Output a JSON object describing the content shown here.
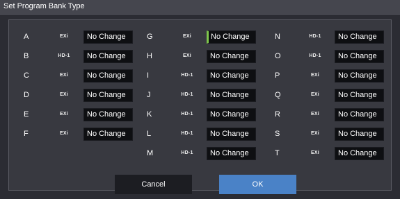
{
  "dialog": {
    "title": "Set Program Bank Type"
  },
  "columns": [
    {
      "rows": [
        {
          "bank": "A",
          "type": "EXi",
          "value": "No Change"
        },
        {
          "bank": "B",
          "type": "HD-1",
          "value": "No Change"
        },
        {
          "bank": "C",
          "type": "EXi",
          "value": "No Change"
        },
        {
          "bank": "D",
          "type": "EXi",
          "value": "No Change"
        },
        {
          "bank": "E",
          "type": "EXi",
          "value": "No Change"
        },
        {
          "bank": "F",
          "type": "EXi",
          "value": "No Change"
        }
      ]
    },
    {
      "rows": [
        {
          "bank": "G",
          "type": "EXi",
          "value": "No Change"
        },
        {
          "bank": "H",
          "type": "EXi",
          "value": "No Change"
        },
        {
          "bank": "I",
          "type": "HD-1",
          "value": "No Change"
        },
        {
          "bank": "J",
          "type": "HD-1",
          "value": "No Change"
        },
        {
          "bank": "K",
          "type": "HD-1",
          "value": "No Change"
        },
        {
          "bank": "L",
          "type": "HD-1",
          "value": "No Change"
        },
        {
          "bank": "M",
          "type": "HD-1",
          "value": "No Change"
        }
      ]
    },
    {
      "rows": [
        {
          "bank": "N",
          "type": "HD-1",
          "value": "No Change"
        },
        {
          "bank": "O",
          "type": "HD-1",
          "value": "No Change"
        },
        {
          "bank": "P",
          "type": "EXi",
          "value": "No Change"
        },
        {
          "bank": "Q",
          "type": "EXi",
          "value": "No Change"
        },
        {
          "bank": "R",
          "type": "EXi",
          "value": "No Change"
        },
        {
          "bank": "S",
          "type": "EXi",
          "value": "No Change"
        },
        {
          "bank": "T",
          "type": "EXi",
          "value": "No Change"
        }
      ]
    }
  ],
  "buttons": {
    "cancel": "Cancel",
    "ok": "OK"
  },
  "colors": {
    "accent": "#4a82c7",
    "focus": "#7ec64c",
    "field_bg": "#0e0f12",
    "panel_bg": "#383940"
  }
}
